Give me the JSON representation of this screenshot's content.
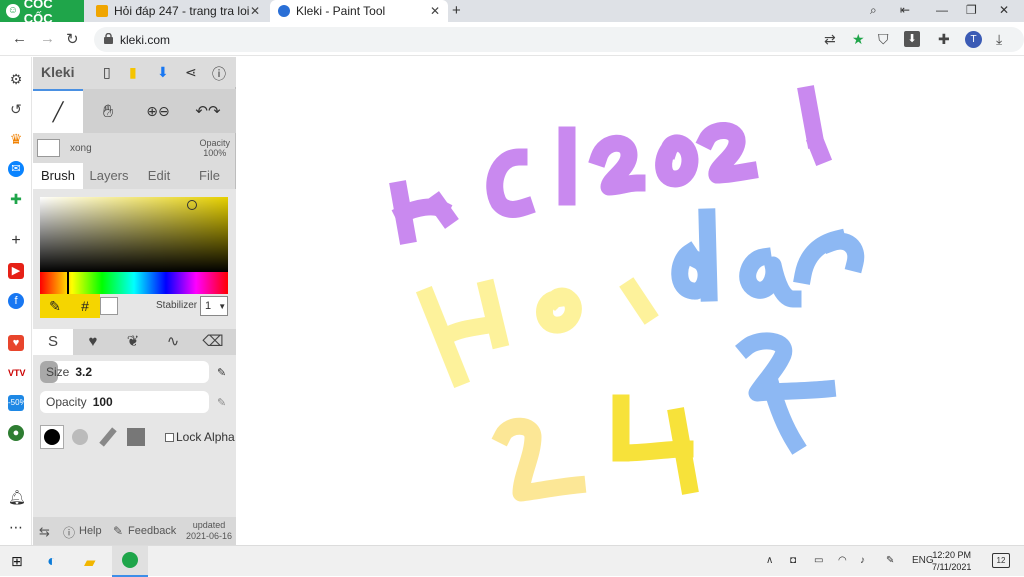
{
  "browser": {
    "brand": "CỐC CỐC",
    "tabs": [
      {
        "title": "Hỏi đáp 247 - trang tra loi",
        "favicon_color": "#f0a500"
      },
      {
        "title": "Kleki - Paint Tool",
        "favicon_color": "#2a6fd6"
      }
    ],
    "url": "kleki.com",
    "profile_initial": "T"
  },
  "kleki": {
    "logo": "Kleki",
    "layer_name": "xong",
    "opacity_label": "Opacity",
    "opacity_value": "100%",
    "tabs": [
      "Brush",
      "Layers",
      "Edit",
      "File"
    ],
    "active_tab": "Brush",
    "stabilizer_label": "Stabilizer",
    "stabilizer_value": "1",
    "size_label": "Size",
    "size_value": "3.2",
    "size_fraction": 0.1,
    "opacity_slider_label": "Opacity",
    "opacity_slider_value": "100",
    "lock_alpha": "Lock Alpha",
    "footer": {
      "help": "Help",
      "feedback": "Feedback",
      "updated_label": "updated",
      "updated_date": "2021-06-16"
    },
    "colors": {
      "primary": "#000000",
      "secondary": "#ffffff",
      "picker_hue": "#e6d000"
    }
  },
  "canvas_text": {
    "line1": "HC!2021",
    "line2a": "Hoi",
    "line2b": "dap",
    "line3a": "24",
    "line3b": "7",
    "colors": {
      "purple": "#c989ef",
      "lightyellow": "#fdf29b",
      "blue": "#8db8f3",
      "yellow": "#f7e23a",
      "paleyellow": "#fce796"
    }
  },
  "taskbar": {
    "lang": "ENG",
    "time": "12:20 PM",
    "date": "7/11/2021",
    "notif_count": "12"
  }
}
